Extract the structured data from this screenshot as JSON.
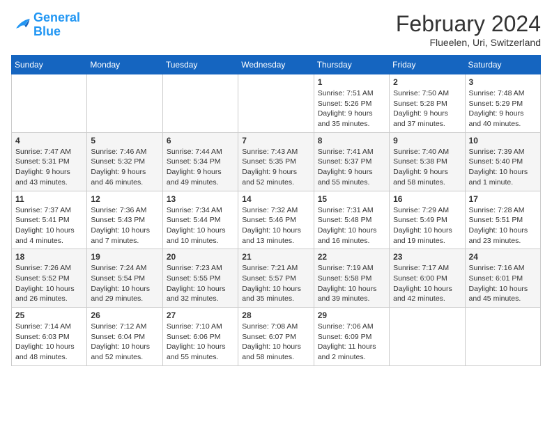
{
  "header": {
    "logo_general": "General",
    "logo_blue": "Blue",
    "month": "February 2024",
    "location": "Flueelen, Uri, Switzerland"
  },
  "weekdays": [
    "Sunday",
    "Monday",
    "Tuesday",
    "Wednesday",
    "Thursday",
    "Friday",
    "Saturday"
  ],
  "weeks": [
    [
      {
        "day": "",
        "info": ""
      },
      {
        "day": "",
        "info": ""
      },
      {
        "day": "",
        "info": ""
      },
      {
        "day": "",
        "info": ""
      },
      {
        "day": "1",
        "info": "Sunrise: 7:51 AM\nSunset: 5:26 PM\nDaylight: 9 hours\nand 35 minutes."
      },
      {
        "day": "2",
        "info": "Sunrise: 7:50 AM\nSunset: 5:28 PM\nDaylight: 9 hours\nand 37 minutes."
      },
      {
        "day": "3",
        "info": "Sunrise: 7:48 AM\nSunset: 5:29 PM\nDaylight: 9 hours\nand 40 minutes."
      }
    ],
    [
      {
        "day": "4",
        "info": "Sunrise: 7:47 AM\nSunset: 5:31 PM\nDaylight: 9 hours\nand 43 minutes."
      },
      {
        "day": "5",
        "info": "Sunrise: 7:46 AM\nSunset: 5:32 PM\nDaylight: 9 hours\nand 46 minutes."
      },
      {
        "day": "6",
        "info": "Sunrise: 7:44 AM\nSunset: 5:34 PM\nDaylight: 9 hours\nand 49 minutes."
      },
      {
        "day": "7",
        "info": "Sunrise: 7:43 AM\nSunset: 5:35 PM\nDaylight: 9 hours\nand 52 minutes."
      },
      {
        "day": "8",
        "info": "Sunrise: 7:41 AM\nSunset: 5:37 PM\nDaylight: 9 hours\nand 55 minutes."
      },
      {
        "day": "9",
        "info": "Sunrise: 7:40 AM\nSunset: 5:38 PM\nDaylight: 9 hours\nand 58 minutes."
      },
      {
        "day": "10",
        "info": "Sunrise: 7:39 AM\nSunset: 5:40 PM\nDaylight: 10 hours\nand 1 minute."
      }
    ],
    [
      {
        "day": "11",
        "info": "Sunrise: 7:37 AM\nSunset: 5:41 PM\nDaylight: 10 hours\nand 4 minutes."
      },
      {
        "day": "12",
        "info": "Sunrise: 7:36 AM\nSunset: 5:43 PM\nDaylight: 10 hours\nand 7 minutes."
      },
      {
        "day": "13",
        "info": "Sunrise: 7:34 AM\nSunset: 5:44 PM\nDaylight: 10 hours\nand 10 minutes."
      },
      {
        "day": "14",
        "info": "Sunrise: 7:32 AM\nSunset: 5:46 PM\nDaylight: 10 hours\nand 13 minutes."
      },
      {
        "day": "15",
        "info": "Sunrise: 7:31 AM\nSunset: 5:48 PM\nDaylight: 10 hours\nand 16 minutes."
      },
      {
        "day": "16",
        "info": "Sunrise: 7:29 AM\nSunset: 5:49 PM\nDaylight: 10 hours\nand 19 minutes."
      },
      {
        "day": "17",
        "info": "Sunrise: 7:28 AM\nSunset: 5:51 PM\nDaylight: 10 hours\nand 23 minutes."
      }
    ],
    [
      {
        "day": "18",
        "info": "Sunrise: 7:26 AM\nSunset: 5:52 PM\nDaylight: 10 hours\nand 26 minutes."
      },
      {
        "day": "19",
        "info": "Sunrise: 7:24 AM\nSunset: 5:54 PM\nDaylight: 10 hours\nand 29 minutes."
      },
      {
        "day": "20",
        "info": "Sunrise: 7:23 AM\nSunset: 5:55 PM\nDaylight: 10 hours\nand 32 minutes."
      },
      {
        "day": "21",
        "info": "Sunrise: 7:21 AM\nSunset: 5:57 PM\nDaylight: 10 hours\nand 35 minutes."
      },
      {
        "day": "22",
        "info": "Sunrise: 7:19 AM\nSunset: 5:58 PM\nDaylight: 10 hours\nand 39 minutes."
      },
      {
        "day": "23",
        "info": "Sunrise: 7:17 AM\nSunset: 6:00 PM\nDaylight: 10 hours\nand 42 minutes."
      },
      {
        "day": "24",
        "info": "Sunrise: 7:16 AM\nSunset: 6:01 PM\nDaylight: 10 hours\nand 45 minutes."
      }
    ],
    [
      {
        "day": "25",
        "info": "Sunrise: 7:14 AM\nSunset: 6:03 PM\nDaylight: 10 hours\nand 48 minutes."
      },
      {
        "day": "26",
        "info": "Sunrise: 7:12 AM\nSunset: 6:04 PM\nDaylight: 10 hours\nand 52 minutes."
      },
      {
        "day": "27",
        "info": "Sunrise: 7:10 AM\nSunset: 6:06 PM\nDaylight: 10 hours\nand 55 minutes."
      },
      {
        "day": "28",
        "info": "Sunrise: 7:08 AM\nSunset: 6:07 PM\nDaylight: 10 hours\nand 58 minutes."
      },
      {
        "day": "29",
        "info": "Sunrise: 7:06 AM\nSunset: 6:09 PM\nDaylight: 11 hours\nand 2 minutes."
      },
      {
        "day": "",
        "info": ""
      },
      {
        "day": "",
        "info": ""
      }
    ]
  ]
}
